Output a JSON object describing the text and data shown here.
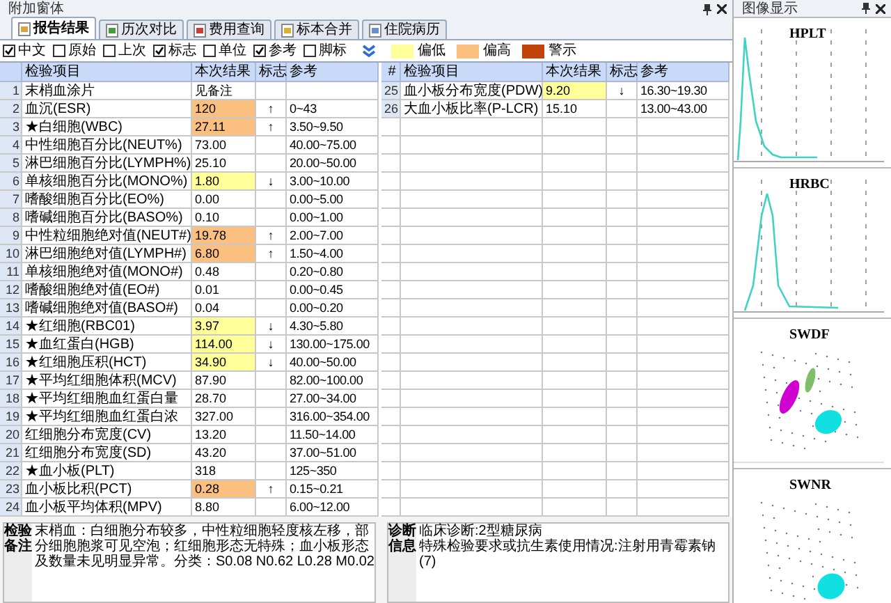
{
  "panel": {
    "title": "附加窗体"
  },
  "tabs": [
    {
      "label": "报告结果",
      "selected": true
    },
    {
      "label": "历次对比",
      "selected": false
    },
    {
      "label": "费用查询",
      "selected": false
    },
    {
      "label": "标本合并",
      "selected": false
    },
    {
      "label": "住院病历",
      "selected": false
    }
  ],
  "options": [
    {
      "label": "中文",
      "checked": true
    },
    {
      "label": "原始",
      "checked": false
    },
    {
      "label": "上次",
      "checked": false
    },
    {
      "label": "标志",
      "checked": true
    },
    {
      "label": "单位",
      "checked": false
    },
    {
      "label": "参考",
      "checked": true
    },
    {
      "label": "脚标",
      "checked": false
    }
  ],
  "legend": [
    {
      "label": "偏低",
      "color": "#ffff99"
    },
    {
      "label": "偏高",
      "color": "#fbbf80"
    },
    {
      "label": "警示",
      "color": "#c0440a"
    }
  ],
  "left_table": {
    "columns": [
      "检验项目",
      "本次结果",
      "标志",
      "参考"
    ],
    "rows": [
      {
        "index": "1",
        "item": "末梢血涂片",
        "result": "见备注"
      },
      {
        "index": "2",
        "item": "血沉(ESR)",
        "result": "120",
        "flag": "↑",
        "reference": "0~43",
        "color": "#fbbf80"
      },
      {
        "index": "3",
        "item": "★白细胞(WBC)",
        "result": "27.11",
        "flag": "↑",
        "reference": "3.50~9.50",
        "color": "#fbbf80"
      },
      {
        "index": "4",
        "item": "中性细胞百分比(NEUT%)",
        "result": "73.00",
        "reference": "40.00~75.00"
      },
      {
        "index": "5",
        "item": "淋巴细胞百分比(LYMPH%)",
        "result": "25.10",
        "reference": "20.00~50.00"
      },
      {
        "index": "6",
        "item": "单核细胞百分比(MONO%)",
        "result": "1.80",
        "flag": "↓",
        "reference": "3.00~10.00",
        "color": "#ffff99"
      },
      {
        "index": "7",
        "item": "嗜酸细胞百分比(EO%)",
        "result": "0.00",
        "reference": "0.00~5.00"
      },
      {
        "index": "8",
        "item": "嗜碱细胞百分比(BASO%)",
        "result": "0.10",
        "reference": "0.00~1.00"
      },
      {
        "index": "9",
        "item": "中性粒细胞绝对值(NEUT#)",
        "result": "19.78",
        "flag": "↑",
        "reference": "2.00~7.00",
        "color": "#fbbf80"
      },
      {
        "index": "10",
        "item": "淋巴细胞绝对值(LYMPH#)",
        "result": "6.80",
        "flag": "↑",
        "reference": "1.50~4.00",
        "color": "#fbbf80"
      },
      {
        "index": "11",
        "item": "单核细胞绝对值(MONO#)",
        "result": "0.48",
        "reference": "0.20~0.80"
      },
      {
        "index": "12",
        "item": "嗜酸细胞绝对值(EO#)",
        "result": "0.01",
        "reference": "0.00~0.45"
      },
      {
        "index": "13",
        "item": "嗜碱细胞绝对值(BASO#)",
        "result": "0.04",
        "reference": "0.00~0.20"
      },
      {
        "index": "14",
        "item": "★红细胞(RBC01)",
        "result": "3.97",
        "flag": "↓",
        "reference": "4.30~5.80",
        "color": "#ffff99"
      },
      {
        "index": "15",
        "item": "★血红蛋白(HGB)",
        "result": "114.00",
        "flag": "↓",
        "reference": "130.00~175.00",
        "color": "#ffff99"
      },
      {
        "index": "16",
        "item": "★红细胞压积(HCT)",
        "result": "34.90",
        "flag": "↓",
        "reference": "40.00~50.00",
        "color": "#ffff99"
      },
      {
        "index": "17",
        "item": "★平均红细胞体积(MCV)",
        "result": "87.90",
        "reference": "82.00~100.00"
      },
      {
        "index": "18",
        "item": "★平均红细胞血红蛋白量",
        "result": "28.70",
        "reference": "27.00~34.00"
      },
      {
        "index": "19",
        "item": "★平均红细胞血红蛋白浓",
        "result": "327.00",
        "reference": "316.00~354.00"
      },
      {
        "index": "20",
        "item": "红细胞分布宽度(CV)",
        "result": "13.20",
        "reference": "11.50~14.00"
      },
      {
        "index": "21",
        "item": "红细胞分布宽度(SD)",
        "result": "43.20",
        "reference": "37.00~51.00"
      },
      {
        "index": "22",
        "item": "★血小板(PLT)",
        "result": "318",
        "reference": "125~350"
      },
      {
        "index": "23",
        "item": "血小板比积(PCT)",
        "result": "0.28",
        "flag": "↑",
        "reference": "0.15~0.21",
        "color": "#fbbf80"
      },
      {
        "index": "24",
        "item": "血小板平均体积(MPV)",
        "result": "8.80",
        "reference": "6.00~12.00"
      }
    ]
  },
  "right_table": {
    "columns": [
      "#",
      "检验项目",
      "本次结果",
      "标志",
      "参考"
    ],
    "rows": [
      {
        "index": "25",
        "item": "血小板分布宽度(PDW)",
        "result": "9.20",
        "flag": "↓",
        "reference": "16.30~19.30",
        "color": "#ffff99"
      },
      {
        "index": "26",
        "item": "大血小板比率(P-LCR)",
        "result": "15.10",
        "reference": "13.00~43.00"
      }
    ]
  },
  "notes": {
    "label": "检验备注",
    "text": "末梢血：白细胞分布较多，中性粒细胞轻度核左移，部分细胞胞浆可见空泡；红细胞形态无特殊；血小板形态及数量未见明显异常。分类：S0.08 N0.62 L0.28 M0.02"
  },
  "diagnosis": {
    "label": "诊断信息",
    "lines": [
      "临床诊断:2型糖尿病",
      "特殊检验要求或抗生素使用情况:注射用青霉素钠(7)"
    ]
  },
  "image_panel": {
    "title": "图像显示",
    "plots": [
      {
        "label": "HPLT",
        "kind": "histogram"
      },
      {
        "label": "HRBC",
        "kind": "histogram"
      },
      {
        "label": "SWDF",
        "kind": "scatter"
      },
      {
        "label": "SWNR",
        "kind": "scatter"
      }
    ]
  }
}
